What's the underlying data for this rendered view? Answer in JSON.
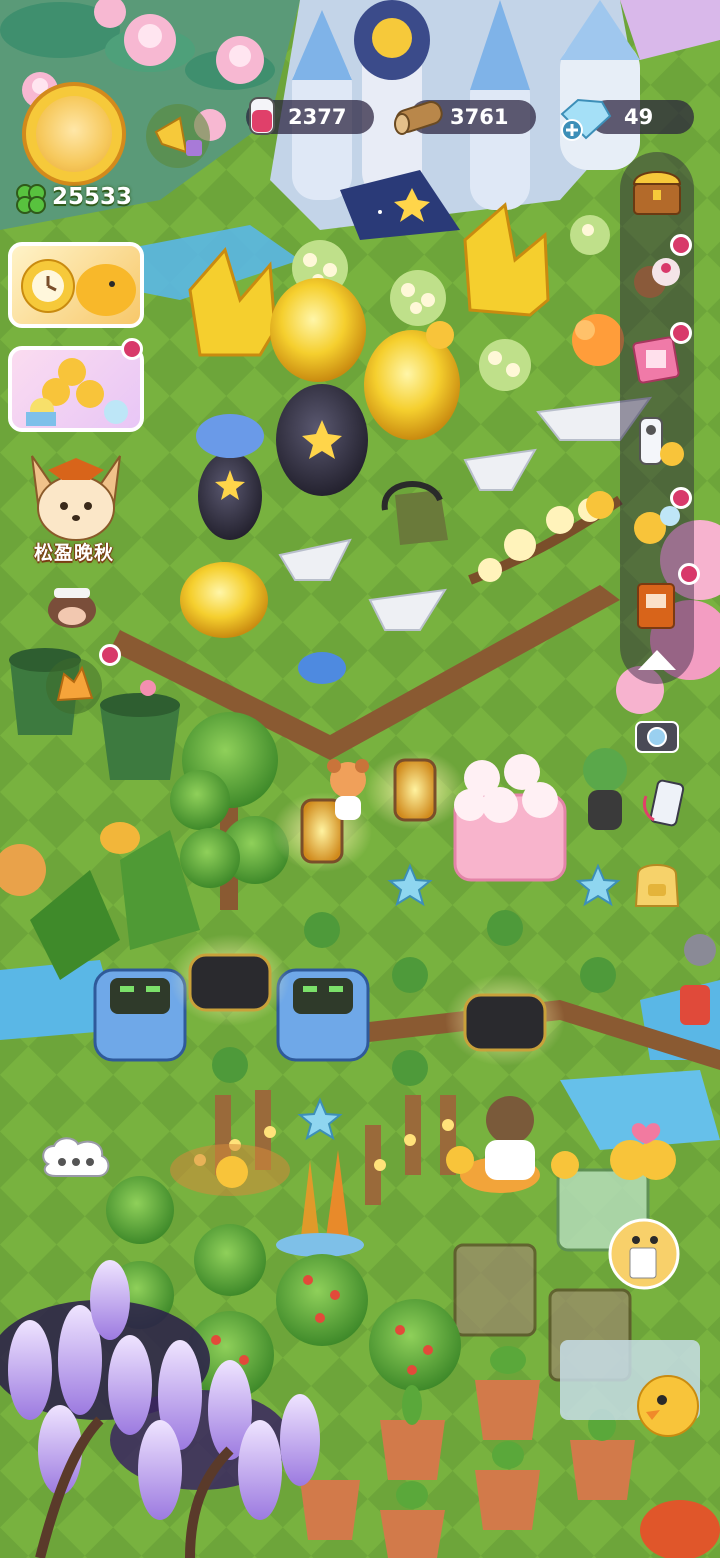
{
  "hud": {
    "potion_count": "2377",
    "wood_count": "3761",
    "gem_count": "49",
    "clover_count": "25533"
  },
  "event": {
    "label": "松盈晚秋"
  },
  "icons": {
    "potion": "pink-potion-icon",
    "wood": "wood-log-icon",
    "gem": "crystal-gem-icon",
    "clover": "clover-icon",
    "add": "plus-icon",
    "megaphone": "megaphone-icon",
    "chat": "chat-bubble-icon"
  },
  "colors": {
    "grass": "#6ea83a",
    "hud_pill": "#2b2040",
    "potion_bar": "#e0406a",
    "gem_bar": "#5fb8e8",
    "notification": "#d8396a"
  }
}
